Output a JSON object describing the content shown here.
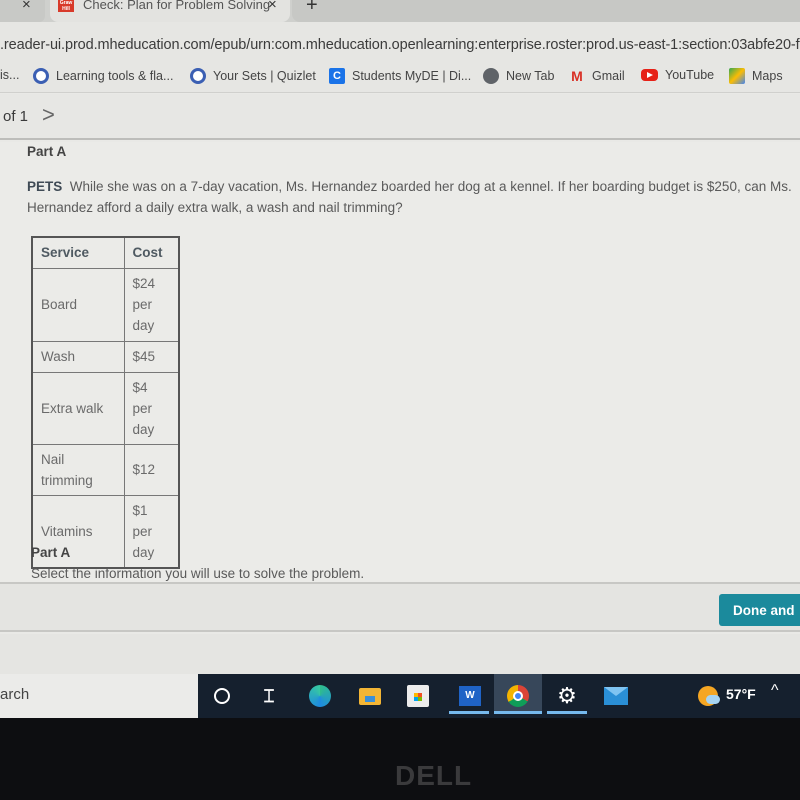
{
  "browser": {
    "tabs": [
      {
        "title": "",
        "active": false
      },
      {
        "title": "Check: Plan for Problem Solving",
        "active": true,
        "favicon_text": "Graw Hill"
      }
    ],
    "close_glyph": "×",
    "new_tab_glyph": "+",
    "url": ".reader-ui.prod.mheducation.com/epub/urn:com.mheducation.openlearning:enterprise.roster:prod.us-east-1:section:03abfe20-f",
    "bookmarks": [
      {
        "label": "is...",
        "icon": "none"
      },
      {
        "label": "Learning tools & fla...",
        "icon": "quizlet-icon"
      },
      {
        "label": "Your Sets | Quizlet",
        "icon": "quizlet-icon"
      },
      {
        "label": "Students MyDE | Di...",
        "icon": "classlink-icon"
      },
      {
        "label": "New Tab",
        "icon": "globe-icon"
      },
      {
        "label": "Gmail",
        "icon": "gmail-icon"
      },
      {
        "label": "YouTube",
        "icon": "youtube-icon"
      },
      {
        "label": "Maps",
        "icon": "maps-icon"
      }
    ]
  },
  "pager": {
    "text": "of 1",
    "next_glyph": ">"
  },
  "question": {
    "part_label": "Part A",
    "topic": "PETS",
    "text": "While she was on a 7-day vacation, Ms. Hernandez boarded her dog at a kennel. If her boarding budget is $250, can Ms. Hernandez afford a daily extra walk, a wash and nail trimming?",
    "table": {
      "headers": [
        "Service",
        "Cost"
      ],
      "rows": [
        {
          "service": "Board",
          "cost": "$24 per day"
        },
        {
          "service": "Wash",
          "cost": "$45"
        },
        {
          "service": "Extra walk",
          "cost": "$4 per day"
        },
        {
          "service": "Nail trimming",
          "cost": "$12"
        },
        {
          "service": "Vitamins",
          "cost": "$1 per day"
        }
      ]
    },
    "sub_part_label": "Part A",
    "instruction": "Select the information you will use to solve the problem."
  },
  "footer": {
    "done_button": "Done and",
    "accent": "#1b8a9c"
  },
  "taskbar": {
    "search_text": "arch",
    "apps": [
      "cortana-icon",
      "task-view-icon",
      "edge-icon",
      "file-explorer-icon",
      "store-icon",
      "word-icon",
      "chrome-icon",
      "settings-icon",
      "mail-icon"
    ],
    "word_letter": "W",
    "task_view_glyph": "⌶",
    "settings_glyph": "⚙",
    "temperature": "57°F",
    "tray_glyph": "^"
  },
  "bezel": {
    "brand": "DELL"
  }
}
